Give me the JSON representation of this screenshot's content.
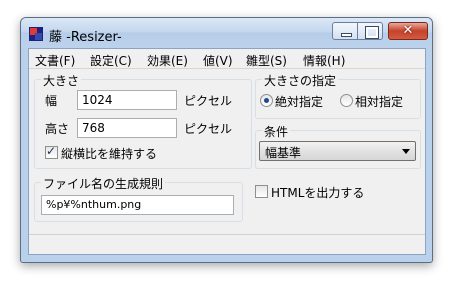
{
  "window": {
    "title_kanji": "藤",
    "title_text": "-Resizer-",
    "minimize_icon": "minimize-icon",
    "maximize_icon": "maximize-icon",
    "close_glyph": "✕"
  },
  "menu": {
    "items": [
      "文書(F)",
      "設定(C)",
      "効果(E)",
      "値(V)",
      "雛型(S)",
      "情報(H)"
    ]
  },
  "size_group": {
    "label": "大きさ",
    "width_label": "幅",
    "width_value": "1024",
    "width_unit": "ピクセル",
    "height_label": "高さ",
    "height_value": "768",
    "height_unit": "ピクセル",
    "keep_ratio_label": "縦横比を維持する",
    "keep_ratio_checked": true
  },
  "size_spec_group": {
    "label": "大きさの指定",
    "absolute_label": "絶対指定",
    "relative_label": "相対指定",
    "selected": "absolute"
  },
  "condition_group": {
    "label": "条件",
    "selected": "幅基準"
  },
  "filename_group": {
    "label": "ファイル名の生成規則",
    "value": "%p¥%nthum.png"
  },
  "html_output": {
    "label": "HTMLを出力する",
    "checked": false
  },
  "colors": {
    "frame": "#b9d1ea",
    "client": "#f0f0f0",
    "close_button": "#c4432c"
  }
}
